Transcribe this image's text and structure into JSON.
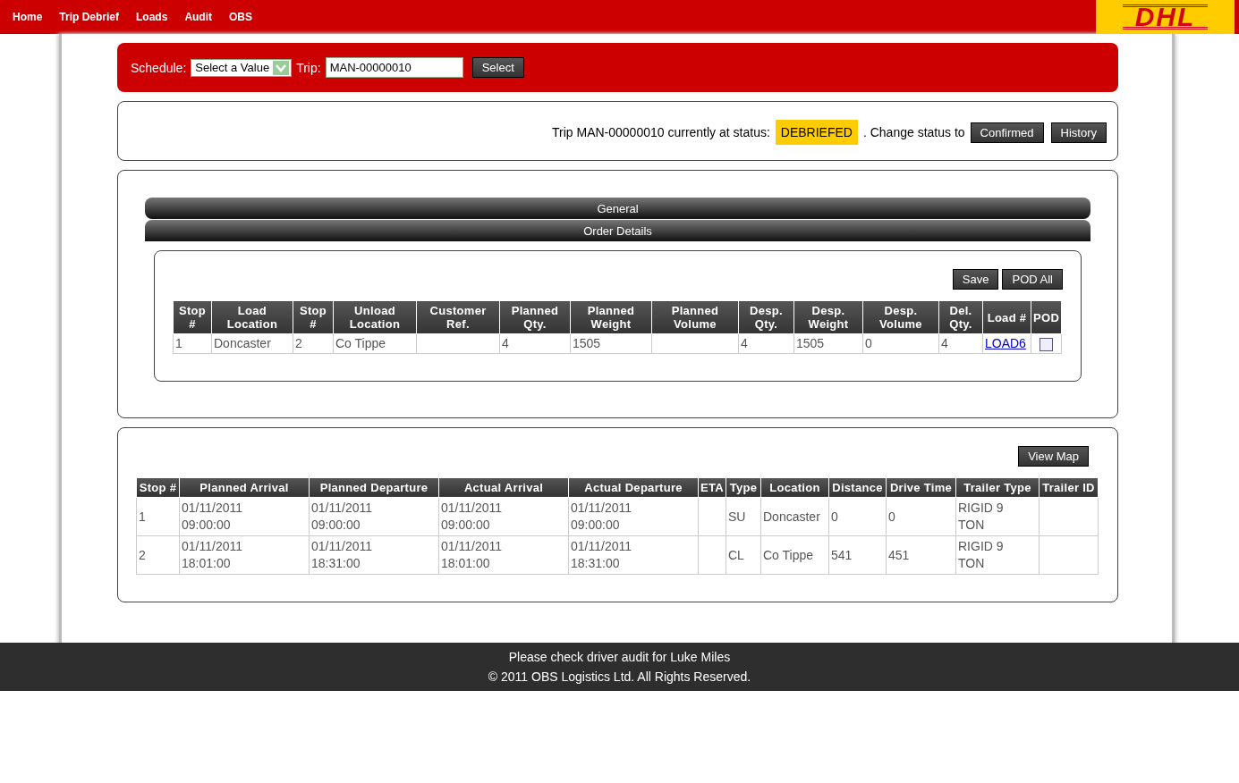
{
  "nav": {
    "items": [
      "Home",
      "Trip Debrief",
      "Loads",
      "Audit",
      "OBS"
    ],
    "logo": "DHL"
  },
  "selector": {
    "schedule_label": "Schedule:",
    "schedule_value": "Select a Value",
    "trip_label": "Trip:",
    "trip_value": "MAN-00000010",
    "button": "Select"
  },
  "status": {
    "text": "Trip MAN-00000010 currently at status:",
    "status": "DEBRIEFED",
    "change_text": ". Change status to",
    "buttons": [
      "Confirmed",
      "History"
    ]
  },
  "accordion": [
    {
      "label": "General",
      "expanded": false
    },
    {
      "label": "Order Details",
      "expanded": true
    }
  ],
  "orders": {
    "buttons": [
      "Save",
      "POD All"
    ],
    "columns": [
      "Stop #",
      "Load Location",
      "Stop #",
      "Unload Location",
      "Customer Ref.",
      "Planned Qty.",
      "Planned Weight",
      "Planned Volume",
      "Desp. Qty.",
      "Desp. Weight",
      "Desp. Volume",
      "Del. Qty.",
      "Load #",
      "POD"
    ],
    "rows": [
      {
        "cells": [
          "1",
          "Doncaster",
          "2",
          "Co Tippe",
          "",
          "4",
          "1505",
          "",
          "4",
          "1505",
          "0",
          "4"
        ],
        "load": "LOAD6",
        "pod_checked": false
      }
    ]
  },
  "stops": {
    "button": "View Map",
    "columns": [
      "Stop #",
      "Planned Arrival",
      "Planned Departure",
      "Actual Arrival",
      "Actual Departure",
      "ETA",
      "Type",
      "Location",
      "Distance",
      "Drive Time",
      "Trailer Type",
      "Trailer ID"
    ],
    "rows": [
      [
        "1",
        "01/11/2011 09:00:00",
        "01/11/2011 09:00:00",
        "01/11/2011 09:00:00",
        "01/11/2011 09:00:00",
        "",
        "SU",
        "Doncaster",
        "0",
        "0",
        "RIGID 9 TON",
        ""
      ],
      [
        "2",
        "01/11/2011 18:01:00",
        "01/11/2011 18:31:00",
        "01/11/2011 18:01:00",
        "01/11/2011 18:31:00",
        "",
        "CL",
        "Co Tippe",
        "541",
        "451",
        "RIGID 9 TON",
        ""
      ]
    ]
  },
  "footer": [
    "Please check driver audit for Luke Miles",
    "© 2011 OBS Logistics Ltd. All Rights Reserved."
  ]
}
